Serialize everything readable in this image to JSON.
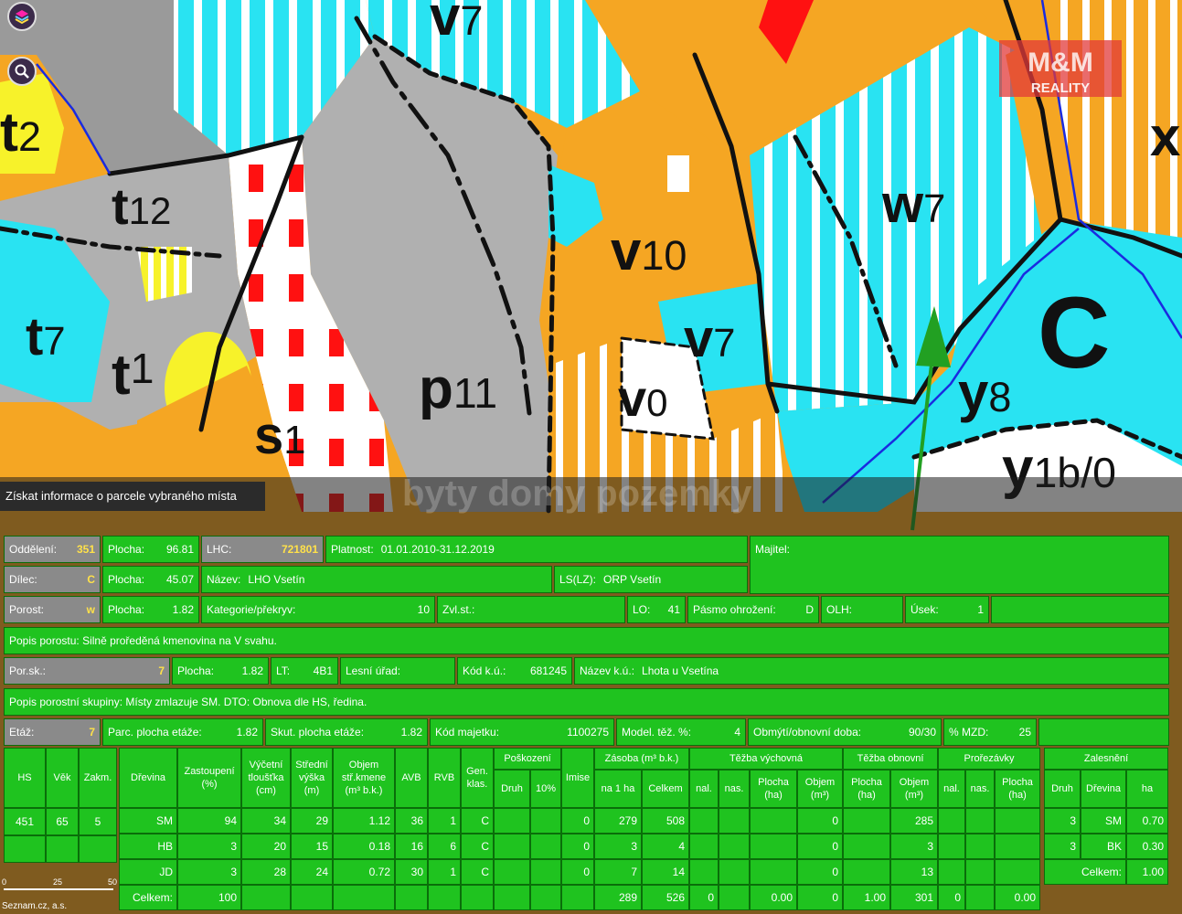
{
  "map": {
    "labels": [
      {
        "main": "t",
        "sub": "2"
      },
      {
        "main": "t",
        "sub": "12"
      },
      {
        "main": "t",
        "sub": "7"
      },
      {
        "main": "t",
        "sub": "1"
      },
      {
        "main": "s",
        "sub": "1"
      },
      {
        "main": "p",
        "sub": "11"
      },
      {
        "main": "v",
        "sub": "10"
      },
      {
        "main": "v",
        "sub": "7"
      },
      {
        "main": "v",
        "sub": "0"
      },
      {
        "main": "v",
        "sub": "7"
      },
      {
        "main": "w",
        "sub": "7"
      },
      {
        "main": "C",
        "sub": ""
      },
      {
        "main": "y",
        "sub": "8"
      },
      {
        "main": "y",
        "sub": "1b/0"
      },
      {
        "main": "x",
        "sub": ""
      }
    ],
    "watermark": "byty domy pozemky",
    "logo": "M&M HOLDING REALITY",
    "scale_labels": [
      "0",
      "25",
      "50"
    ],
    "copyright": "Seznam.cz, a.s.",
    "colors": {
      "orange": "#f5a623",
      "cyan": "#29e3f2",
      "gray": "#b0b0b0",
      "red": "#ff1111",
      "yellow": "#f7f22a",
      "green": "#1fc31f"
    }
  },
  "toolbar": {
    "layers_icon": "layers-icon",
    "zoom_icon": "zoom-icon"
  },
  "info": {
    "title": "Získat informace o parcele vybraného místa",
    "row1": {
      "oddeleni_label": "Oddělení:",
      "oddeleni_value": "351",
      "plocha_label": "Plocha:",
      "plocha_value": "96.81",
      "lhc_label": "LHC:",
      "lhc_value": "721801",
      "platnost_label": "Platnost:",
      "platnost_value": "01.01.2010-31.12.2019",
      "majitel_label": "Majitel:"
    },
    "row2": {
      "dilec_label": "Dílec:",
      "dilec_value": "C",
      "plocha_label": "Plocha:",
      "plocha_value": "45.07",
      "nazev_label": "Název:",
      "nazev_value": "LHO Vsetín",
      "ls_label": "LS(LZ):",
      "ls_value": "ORP Vsetín"
    },
    "row3": {
      "porost_label": "Porost:",
      "porost_value": "w",
      "plocha_label": "Plocha:",
      "plocha_value": "1.82",
      "kategorie_label": "Kategorie/překryv:",
      "kategorie_value": "10",
      "zvl_label": "Zvl.st.:",
      "lo_label": "LO:",
      "lo_value": "41",
      "pasmo_label": "Pásmo ohrožení:",
      "pasmo_value": "D",
      "olh_label": "OLH:",
      "usek_label": "Úsek:",
      "usek_value": "1"
    },
    "row4": {
      "popis_label": "Popis porostu:",
      "popis_value": "Silně proředěná kmenovina na V svahu."
    },
    "row5": {
      "porsk_label": "Por.sk.:",
      "porsk_value": "7",
      "plocha_label": "Plocha:",
      "plocha_value": "1.82",
      "lt_label": "LT:",
      "lt_value": "4B1",
      "lesni_label": "Lesní úřad:",
      "kodku_label": "Kód k.ú.:",
      "kodku_value": "681245",
      "nazevku_label": "Název k.ú.:",
      "nazevku_value": "Lhota u Vsetína"
    },
    "row6": {
      "popis_label": "Popis porostní skupiny:",
      "popis_value": "Místy zmlazuje SM. DTO: Obnova dle HS, ředina."
    },
    "row7": {
      "etaz_label": "Etáž:",
      "etaz_value": "7",
      "parc_label": "Parc. plocha etáže:",
      "parc_value": "1.82",
      "skut_label": "Skut. plocha etáže:",
      "skut_value": "1.82",
      "kodmaj_label": "Kód majetku:",
      "kodmaj_value": "1100275",
      "model_label": "Model. těž. %:",
      "model_value": "4",
      "obmyti_label": "Obmýtí/obnovní doba:",
      "obmyti_value": "90/30",
      "mzd_label": "% MZD:",
      "mzd_value": "25"
    }
  },
  "table": {
    "left_headers": [
      "HS",
      "Věk",
      "Zakm."
    ],
    "left_values": [
      "451",
      "65",
      "5"
    ],
    "main_headers": {
      "drevina": "Dřevina",
      "zastoupeni": "Zastoupení\n(%)",
      "vycetni": "Výčetní\ntloušťka\n(cm)",
      "stredni": "Střední\nvýška\n(m)",
      "objem": "Objem\nstř.kmene\n(m³ b.k.)",
      "avb": "AVB",
      "rvb": "RVB",
      "gen": "Gen.\nklas.",
      "poskozeni": "Poškození",
      "druh": "Druh",
      "p10": "10%",
      "imise": "Imise",
      "zasoba": "Zásoba (m³ b.k.)",
      "na1ha": "na 1 ha",
      "celkem": "Celkem",
      "tezba_vych": "Těžba výchovná",
      "nal": "nal.",
      "nas": "nas.",
      "plocha_ha": "Plocha\n(ha)",
      "objem_m3": "Objem\n(m³)",
      "tezba_obn": "Těžba obnovní",
      "prorezavky": "Prořezávky"
    },
    "rows": [
      {
        "drevina": "SM",
        "zast": "94",
        "tl": "34",
        "vy": "29",
        "obj": "1.12",
        "avb": "36",
        "rvb": "1",
        "gen": "C",
        "druh": "",
        "p10": "",
        "imise": "0",
        "na1ha": "279",
        "celk": "508",
        "vnal": "",
        "vnas": "",
        "vpl": "",
        "vobj": "0",
        "opl": "",
        "oobj": "285",
        "pnal": "",
        "pnas": "",
        "ppl": ""
      },
      {
        "drevina": "HB",
        "zast": "3",
        "tl": "20",
        "vy": "15",
        "obj": "0.18",
        "avb": "16",
        "rvb": "6",
        "gen": "C",
        "druh": "",
        "p10": "",
        "imise": "0",
        "na1ha": "3",
        "celk": "4",
        "vnal": "",
        "vnas": "",
        "vpl": "",
        "vobj": "0",
        "opl": "",
        "oobj": "3",
        "pnal": "",
        "pnas": "",
        "ppl": ""
      },
      {
        "drevina": "JD",
        "zast": "3",
        "tl": "28",
        "vy": "24",
        "obj": "0.72",
        "avb": "30",
        "rvb": "1",
        "gen": "C",
        "druh": "",
        "p10": "",
        "imise": "0",
        "na1ha": "7",
        "celk": "14",
        "vnal": "",
        "vnas": "",
        "vpl": "",
        "vobj": "0",
        "opl": "",
        "oobj": "13",
        "pnal": "",
        "pnas": "",
        "ppl": ""
      }
    ],
    "total": {
      "label": "Celkem:",
      "zast": "100",
      "na1ha": "289",
      "celk": "526",
      "vnal": "0",
      "vpl": "0.00",
      "vobj": "0",
      "opl": "1.00",
      "oobj": "301",
      "pnal": "0",
      "ppl": "0.00"
    },
    "zalesneni": {
      "title": "Zalesnění",
      "headers": [
        "Druh",
        "Dřevina",
        "ha"
      ],
      "rows": [
        {
          "druh": "3",
          "drevina": "SM",
          "ha": "0.70"
        },
        {
          "druh": "3",
          "drevina": "BK",
          "ha": "0.30"
        }
      ],
      "total_label": "Celkem:",
      "total_value": "1.00"
    }
  }
}
